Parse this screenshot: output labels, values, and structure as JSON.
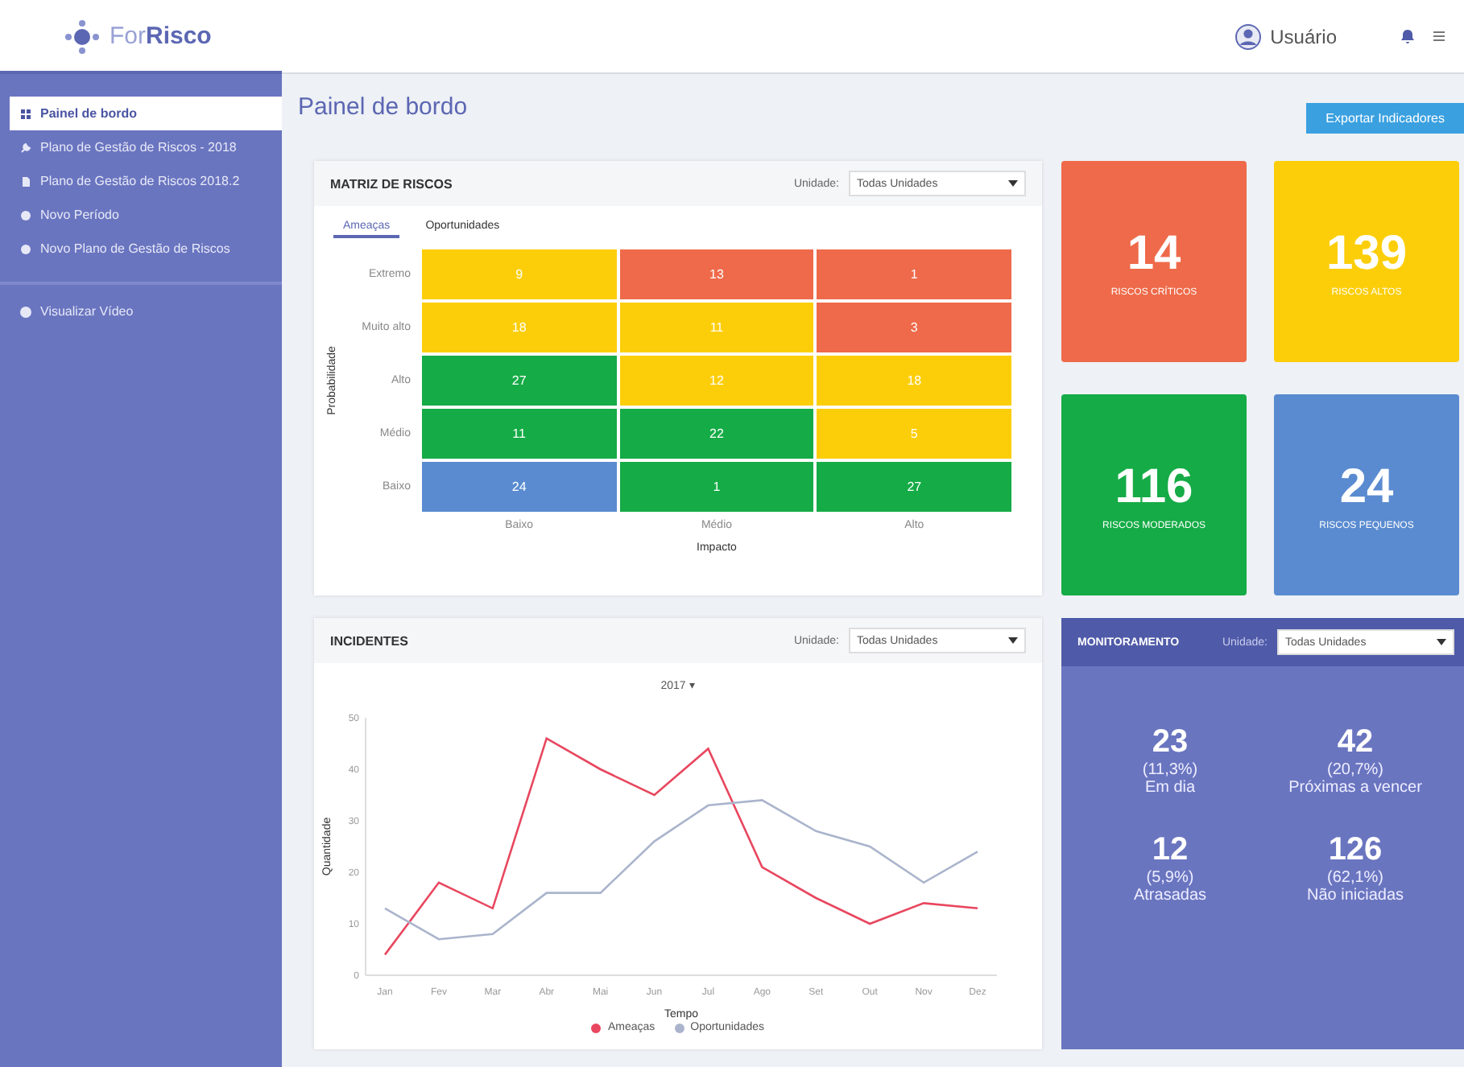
{
  "header": {
    "logo_prefix": "For",
    "logo_name": "Risco",
    "user": "Usuário"
  },
  "sidebar": {
    "items": [
      {
        "label": "Painel de bordo",
        "selected": true
      },
      {
        "label": "Plano de Gestão de Riscos - 2018",
        "selected": false
      },
      {
        "label": "Plano de Gestão de Riscos 2018.2",
        "selected": false
      },
      {
        "label": "Novo Período",
        "selected": false
      },
      {
        "label": "Novo Plano de Gestão de Riscos",
        "selected": false
      }
    ],
    "footer_items": [
      {
        "label": "Visualizar Vídeo",
        "selected": false
      }
    ]
  },
  "page_title": "Painel de bordo",
  "export_button": "Exportar Indicadores",
  "risk_matrix": {
    "title": "MATRIZ DE RISCOS",
    "filter_label": "Unidade:",
    "filter_value": "Todas Unidades",
    "tabs": [
      {
        "label": "Ameaças",
        "selected": true
      },
      {
        "label": "Oportunidades",
        "selected": false
      }
    ],
    "y_axis_label": "Probabilidade",
    "x_axis_label": "Impacto",
    "row_labels": [
      "Extremo",
      "Muito alto",
      "Alto",
      "Médio",
      "Baixo"
    ],
    "column_labels": [
      "Baixo",
      "Médio",
      "Alto"
    ],
    "rows": [
      {
        "cells": [
          {
            "value": "9",
            "color": "#fcce0a"
          },
          {
            "value": "13",
            "color": "#ee6a4a"
          },
          {
            "value": "1",
            "color": "#ee6a4a"
          }
        ]
      },
      {
        "cells": [
          {
            "value": "18",
            "color": "#fcce0a"
          },
          {
            "value": "11",
            "color": "#fcce0a"
          },
          {
            "value": "3",
            "color": "#ee6a4a"
          }
        ]
      },
      {
        "cells": [
          {
            "value": "27",
            "color": "#15ab46"
          },
          {
            "value": "12",
            "color": "#fcce0a"
          },
          {
            "value": "18",
            "color": "#fcce0a"
          }
        ]
      },
      {
        "cells": [
          {
            "value": "11",
            "color": "#15ab46"
          },
          {
            "value": "22",
            "color": "#15ab46"
          },
          {
            "value": "5",
            "color": "#fcce0a"
          }
        ]
      },
      {
        "cells": [
          {
            "value": "24",
            "color": "#5a8bd0"
          },
          {
            "value": "1",
            "color": "#15ab46"
          },
          {
            "value": "27",
            "color": "#15ab46"
          }
        ]
      }
    ]
  },
  "summary_cards": [
    {
      "value": "14",
      "label": "RISCOS CRÍTICOS",
      "color": "#ee6a4a"
    },
    {
      "value": "139",
      "label": "RISCOS ALTOS",
      "color": "#fcce0a"
    },
    {
      "value": "116",
      "label": "RISCOS MODERADOS",
      "color": "#15ab46"
    },
    {
      "value": "24",
      "label": "RISCOS PEQUENOS",
      "color": "#5a8bd0"
    }
  ],
  "incidents": {
    "title": "INCIDENTES",
    "filter_label": "Unidade:",
    "filter_value": "Todas Unidades",
    "period": "2017 ▾",
    "chart_data": {
      "type": "line",
      "xlabel": "Tempo",
      "ylabel": "Quantidade",
      "categories": [
        "Jan",
        "Fev",
        "Mar",
        "Abr",
        "Mai",
        "Jun",
        "Jul",
        "Ago",
        "Set",
        "Out",
        "Nov",
        "Dez"
      ],
      "ylim": [
        0,
        50
      ],
      "yticks": [
        0,
        10,
        20,
        30,
        40,
        50
      ],
      "series": [
        {
          "name": "Ameaças",
          "color": "#e8475f",
          "values": [
            4,
            18,
            13,
            46,
            40,
            35,
            44,
            21,
            15,
            10,
            14,
            13
          ]
        },
        {
          "name": "Oportunidades",
          "color": "#aab4cc",
          "values": [
            13,
            7,
            8,
            16,
            16,
            26,
            33,
            34,
            28,
            25,
            18,
            24
          ]
        }
      ]
    }
  },
  "monitoring": {
    "title": "MONITORAMENTO",
    "filter_label": "Unidade:",
    "filter_value": "Todas Unidades",
    "stats": [
      {
        "value": "23",
        "percent": "(11,3%)",
        "label": "Em dia"
      },
      {
        "value": "42",
        "percent": "(20,7%)",
        "label": "Próximas a vencer"
      },
      {
        "value": "12",
        "percent": "(5,9%)",
        "label": "Atrasadas"
      },
      {
        "value": "126",
        "percent": "(62,1%)",
        "label": "Não iniciadas"
      }
    ]
  }
}
